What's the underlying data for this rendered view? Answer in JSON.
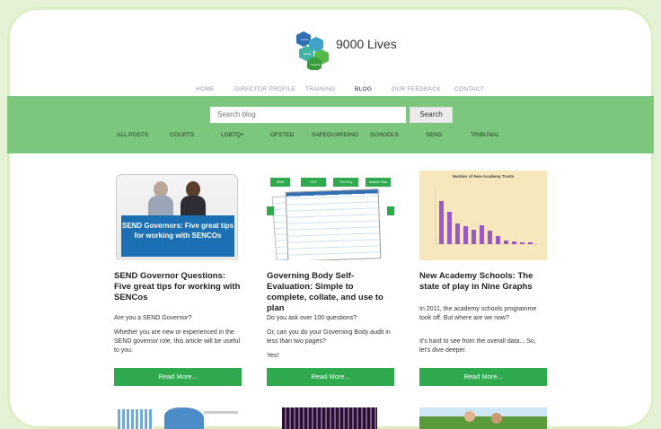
{
  "brand": {
    "name": "9000 Lives"
  },
  "logo_hex_labels": [
    "Focus",
    "Clarity",
    "Support"
  ],
  "top_nav": {
    "items": [
      "HOME",
      "DIRECTOR PROFILE",
      "TRAINING",
      "BLOG",
      "OUR FEEDBACK",
      "CONTACT"
    ],
    "active": "BLOG"
  },
  "search": {
    "placeholder": "Search blog",
    "button": "Search"
  },
  "categories": [
    "ALL POSTS",
    "COURTS",
    "LGBTQ+",
    "OFSTED",
    "SAFEGUARDING",
    "SCHOOLS",
    "SEND",
    "TRIBUNAL"
  ],
  "posts": [
    {
      "image_caption": "SEND Governors: Five great tips for working with SENCOs",
      "title": "SEND Governor Questions: Five great tips for working with SENCos",
      "paragraphs": [
        "Are you a SEND Governor?",
        "Whether you are new or experienced in the SEND governor role, this article will be useful to you."
      ],
      "button": "Read More..."
    },
    {
      "image_tabs": [
        "Whit",
        "LDC",
        "The Key",
        "Action Plan"
      ],
      "title": "Governing Body Self-Evaluation: Simple to complete, collate, and use to plan",
      "paragraphs": [
        "Do you ask over 100 questions?",
        "Or, can you do your Governing Body audit in less than two pages?",
        "Yes!"
      ],
      "button": "Read More..."
    },
    {
      "chart_title": "Number of New Academy Trusts",
      "title": "New Academy Schools: The state of play in Nine Graphs",
      "paragraphs": [
        "In 2011, the academy schools programme took off. But where are we now?",
        "It's hard to see from the overall data... So, let's dive deeper."
      ],
      "button": "Read More..."
    }
  ],
  "colors": {
    "band": "#7cc67e",
    "button": "#2faa4f",
    "chart_bar": "#9b59c6",
    "chart_bg": "#f7e7bd"
  }
}
